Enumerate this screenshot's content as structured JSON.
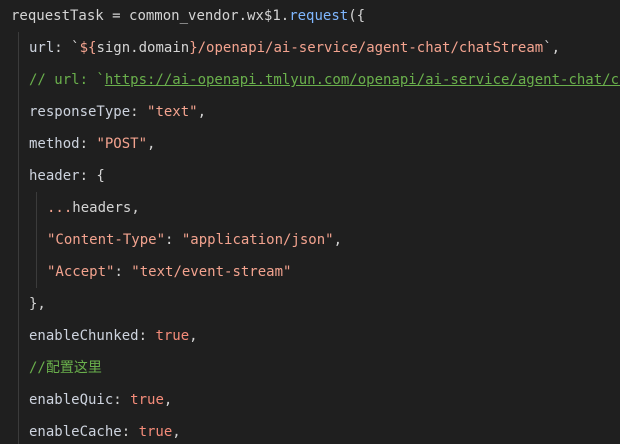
{
  "lines": {
    "l1": {
      "a": "requestTask",
      "b": " = ",
      "c": "common_vendor",
      "d": ".",
      "e": "wx$1",
      "f": ".",
      "g": "request",
      "h": "({"
    },
    "l2": {
      "a": "url",
      "b": ": `",
      "c": "${",
      "d": "sign",
      "e": ".",
      "f": "domain",
      "g": "}",
      "h": "/openapi/ai-service/agent-chat/chatStream",
      "i": "`",
      "j": ","
    },
    "l3": {
      "a": "// url: `",
      "b": "https://ai-openapi.tmlyun.com/openapi/ai-service/agent-chat/chatStream",
      "c": "`,"
    },
    "l4": {
      "a": "responseType",
      "b": ": ",
      "c": "\"text\"",
      "d": ","
    },
    "l5": {
      "a": "method",
      "b": ": ",
      "c": "\"POST\"",
      "d": ","
    },
    "l6": {
      "a": "header",
      "b": ": {"
    },
    "l7": {
      "a": "...",
      "b": "headers",
      "c": ","
    },
    "l8": {
      "a": "\"Content-Type\"",
      "b": ": ",
      "c": "\"application/json\"",
      "d": ","
    },
    "l9": {
      "a": "\"Accept\"",
      "b": ": ",
      "c": "\"text/event-stream\""
    },
    "l10": {
      "a": "},"
    },
    "l11": {
      "a": "enableChunked",
      "b": ": ",
      "c": "true",
      "d": ","
    },
    "l12": {
      "a": "//配置这里"
    },
    "l13": {
      "a": "enableQuic",
      "b": ": ",
      "c": "true",
      "d": ","
    },
    "l14": {
      "a": "enableCache",
      "b": ": ",
      "c": "true",
      "d": ","
    }
  }
}
